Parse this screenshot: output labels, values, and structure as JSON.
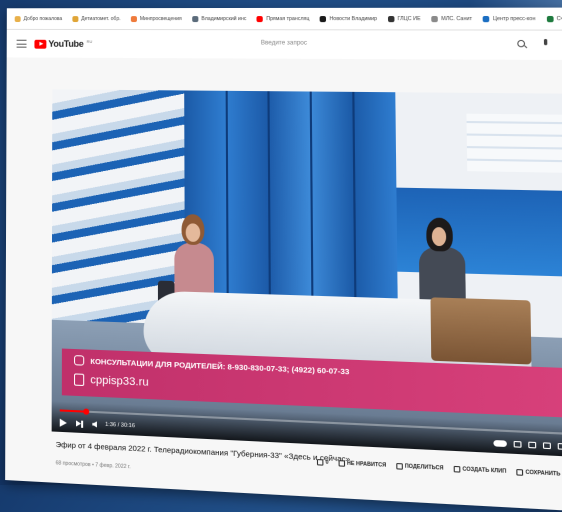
{
  "bookmarks": [
    {
      "label": "Добро пожалова",
      "color": "#e8b04a"
    },
    {
      "label": "Детиатомет. обр.",
      "color": "#e0a537"
    },
    {
      "label": "Минпросвещения",
      "color": "#ef7b3c"
    },
    {
      "label": "Владимирский инс",
      "color": "#5b6b7b"
    },
    {
      "label": "Прямая трансляц",
      "color": "#ff0000"
    },
    {
      "label": "Новости Владимир",
      "color": "#1a1a1a"
    },
    {
      "label": "ГЛЦС ИЕ",
      "color": "#333333"
    },
    {
      "label": "МЛС. Санит",
      "color": "#8a8a8a"
    },
    {
      "label": "Центр пресс-кон",
      "color": "#1b6ec2"
    },
    {
      "label": "Счётная Вла",
      "color": "#1e7a3e"
    }
  ],
  "youtube": {
    "logo_text": "YouTube",
    "region": "RU",
    "search_placeholder": "Введите запрос"
  },
  "player": {
    "lower_third_line1": "КОНСУЛЬТАЦИИ ДЛЯ РОДИТЕЛЕЙ: 8-930-830-07-33; (4922) 60-07-33",
    "lower_third_line2": "cppisp33.ru",
    "time": "1:36 / 30:16",
    "progress_fraction": 0.053
  },
  "video": {
    "title": "Эфир от 4 февраля 2022 г. Телерадиокомпания \"Губерния-33\" «Здесь и сейчас»",
    "meta": "68 просмотров • 7 февр. 2022 г.",
    "actions": [
      {
        "label": "0",
        "icon": "thumbs-up-icon"
      },
      {
        "label": "НЕ НРАВИТСЯ",
        "icon": "thumbs-down-icon"
      },
      {
        "label": "ПОДЕЛИТЬСЯ",
        "icon": "share-icon"
      },
      {
        "label": "СОЗДАТЬ КЛИП",
        "icon": "scissors-icon"
      },
      {
        "label": "СОХРАНИТЬ",
        "icon": "save-playlist-icon"
      },
      {
        "label": "...",
        "icon": "more-icon"
      }
    ]
  }
}
